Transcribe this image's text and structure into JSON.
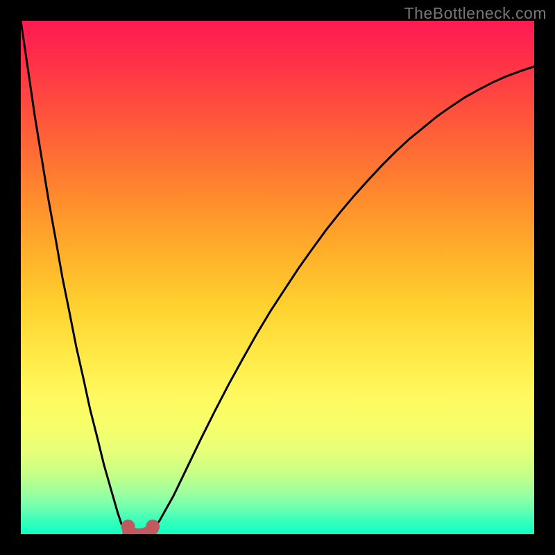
{
  "watermark": "TheBottleneck.com",
  "chart_data": {
    "type": "line",
    "title": "",
    "xlabel": "",
    "ylabel": "",
    "xlim": [
      0,
      100
    ],
    "ylim": [
      0,
      100
    ],
    "grid": false,
    "legend": false,
    "note": "Values estimated from pixel positions; axes are unlabeled in source image. Y is inverted visually (0 at bottom = best / green, 100 at top = worst / red).",
    "series": [
      {
        "name": "left-branch",
        "x": [
          0.0,
          1.4,
          2.7,
          4.1,
          5.4,
          6.8,
          8.1,
          9.5,
          10.8,
          12.2,
          13.5,
          14.9,
          16.2,
          17.6,
          18.9,
          19.6,
          20.3,
          20.9
        ],
        "y": [
          100.0,
          90.5,
          81.6,
          73.0,
          65.1,
          57.4,
          50.0,
          43.1,
          36.5,
          30.3,
          24.3,
          18.8,
          13.5,
          8.6,
          4.1,
          2.0,
          1.0,
          0.5
        ]
      },
      {
        "name": "bottom-segment",
        "x": [
          20.9,
          22.3,
          23.6,
          25.0,
          25.7
        ],
        "y": [
          0.5,
          0.0,
          0.0,
          0.4,
          1.0
        ],
        "style": "thick-dashed",
        "color": "#c15a60"
      },
      {
        "name": "right-branch",
        "x": [
          25.7,
          27.0,
          29.7,
          32.4,
          35.1,
          37.8,
          40.5,
          43.2,
          45.9,
          48.6,
          51.4,
          54.1,
          56.8,
          59.5,
          62.2,
          64.9,
          67.6,
          70.3,
          73.0,
          75.7,
          78.4,
          81.1,
          83.8,
          86.5,
          89.2,
          91.9,
          94.6,
          97.3,
          100.0
        ],
        "y": [
          1.0,
          2.6,
          7.4,
          13.0,
          18.6,
          24.0,
          29.2,
          34.1,
          38.9,
          43.4,
          47.7,
          51.8,
          55.6,
          59.3,
          62.7,
          65.9,
          68.9,
          71.8,
          74.5,
          77.0,
          79.2,
          81.4,
          83.3,
          85.1,
          86.6,
          88.0,
          89.2,
          90.2,
          91.1
        ]
      }
    ],
    "markers": [
      {
        "x": 20.9,
        "y": 1.5,
        "color": "#c15a60"
      },
      {
        "x": 25.7,
        "y": 1.5,
        "color": "#c15a60"
      }
    ],
    "background_gradient": {
      "direction": "vertical",
      "stops": [
        {
          "pos": 0.0,
          "color": "#ff1a52"
        },
        {
          "pos": 0.5,
          "color": "#ffc530"
        },
        {
          "pos": 0.78,
          "color": "#fbff60"
        },
        {
          "pos": 1.0,
          "color": "#0cffc5"
        }
      ]
    }
  }
}
